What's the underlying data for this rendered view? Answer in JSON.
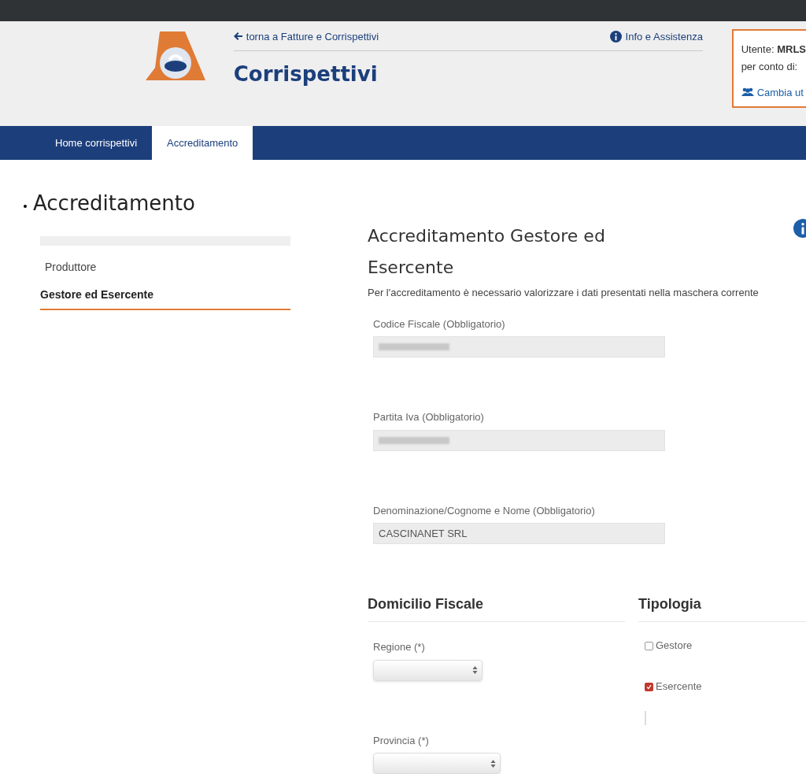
{
  "header": {
    "back_link": "torna a Fatture e Corrispettivi",
    "title": "Corrispettivi",
    "info_link": "Info e Assistenza",
    "user_box": {
      "user_label": "Utente:",
      "user_value": "MRLS",
      "on_behalf_label": "per conto di:",
      "change_link": "Cambia ut"
    }
  },
  "nav": {
    "tabs": [
      {
        "label": "Home corrispettivi",
        "selected": false
      },
      {
        "label": "Accreditamento",
        "selected": true
      }
    ]
  },
  "page_title": "Accreditamento",
  "sidebar": {
    "items": [
      {
        "label": "Produttore",
        "selected": false
      },
      {
        "label": "Gestore ed Esercente",
        "selected": true
      }
    ]
  },
  "form": {
    "title": "Accreditamento Gestore ed Esercente",
    "description": "Per l'accreditamento è necessario valorizzare i dati presentati nella maschera corrente",
    "fields": [
      {
        "label": "Codice Fiscale (Obbligatorio)",
        "redacted": true
      },
      {
        "label": "Partita Iva (Obbligatorio)",
        "redacted": true
      },
      {
        "label": "Denominazione/Cognome e Nome (Obbligatorio)",
        "value": "CASCINANET SRL",
        "redacted": false
      }
    ],
    "domicilio": {
      "title": "Domicilio Fiscale",
      "selects": [
        {
          "label": "Regione (*)"
        },
        {
          "label": "Provincia (*)"
        }
      ]
    },
    "tipologia": {
      "title": "Tipologia",
      "options": [
        {
          "label": "Gestore",
          "checked": false
        },
        {
          "label": "Esercente",
          "checked": true
        }
      ]
    }
  }
}
